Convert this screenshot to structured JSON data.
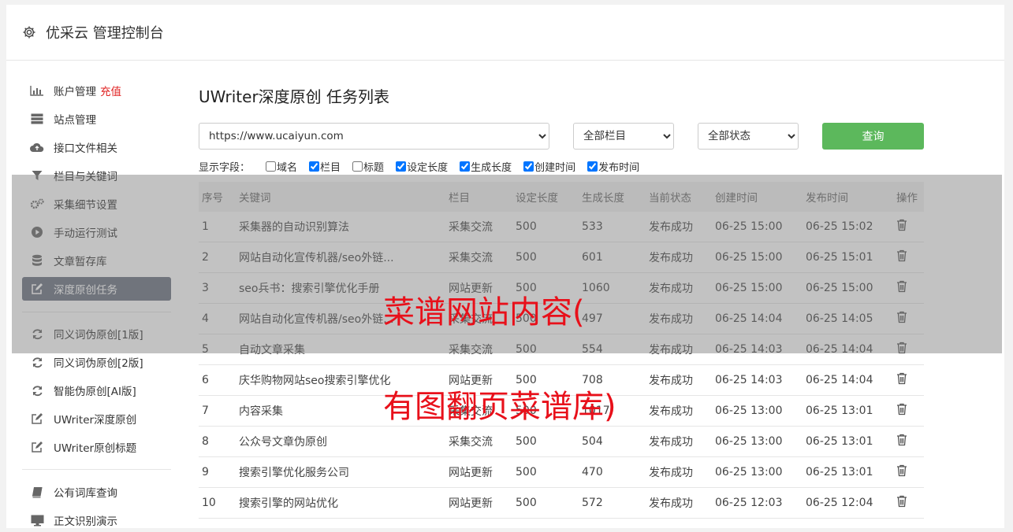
{
  "header": {
    "title": "优采云 管理控制台"
  },
  "sidebar": {
    "items": [
      {
        "label": "账户管理",
        "extra": "充值",
        "icon": "bar-chart-icon"
      },
      {
        "label": "站点管理",
        "icon": "server-icon"
      },
      {
        "label": "接口文件相关",
        "icon": "cloud-upload-icon"
      },
      {
        "label": "栏目与关键词",
        "icon": "filter-icon"
      },
      {
        "label": "采集细节设置",
        "icon": "gears-icon"
      },
      {
        "label": "手动运行测试",
        "icon": "play-circle-icon"
      },
      {
        "label": "文章暂存库",
        "icon": "database-icon"
      },
      {
        "label": "深度原创任务",
        "icon": "edit-icon",
        "active": true
      },
      {
        "label": "同义词伪原创[1版]",
        "icon": "refresh-icon"
      },
      {
        "label": "同义词伪原创[2版]",
        "icon": "refresh-icon"
      },
      {
        "label": "智能伪原创[AI版]",
        "icon": "refresh-icon"
      },
      {
        "label": "UWriter深度原创",
        "icon": "edit-icon"
      },
      {
        "label": "UWriter原创标题",
        "icon": "edit-icon"
      },
      {
        "label": "公有词库查询",
        "icon": "book-icon"
      },
      {
        "label": "正文识别演示",
        "icon": "monitor-icon"
      }
    ]
  },
  "main": {
    "title": "UWriter深度原创 任务列表",
    "site_select": {
      "value": "https://www.ucaiyun.com"
    },
    "column_select": {
      "value": "全部栏目"
    },
    "status_select": {
      "value": "全部状态"
    },
    "query_button": "查询",
    "fields_label": "显示字段：",
    "fields": [
      {
        "label": "域名",
        "checked": false
      },
      {
        "label": "栏目",
        "checked": true
      },
      {
        "label": "标题",
        "checked": false
      },
      {
        "label": "设定长度",
        "checked": true
      },
      {
        "label": "生成长度",
        "checked": true
      },
      {
        "label": "创建时间",
        "checked": true
      },
      {
        "label": "发布时间",
        "checked": true
      }
    ],
    "table": {
      "columns": [
        "序号",
        "关键词",
        "栏目",
        "设定长度",
        "生成长度",
        "当前状态",
        "创建时间",
        "发布时间",
        "操作"
      ],
      "rows": [
        [
          "1",
          "采集器的自动识别算法",
          "采集交流",
          "500",
          "533",
          "发布成功",
          "06-25 15:00",
          "06-25 15:02"
        ],
        [
          "2",
          "网站自动化宣传机器/seo外链...",
          "采集交流",
          "500",
          "601",
          "发布成功",
          "06-25 15:00",
          "06-25 15:01"
        ],
        [
          "3",
          "seo兵书：搜索引擎优化手册",
          "网站更新",
          "500",
          "1060",
          "发布成功",
          "06-25 15:00",
          "06-25 15:00"
        ],
        [
          "4",
          "网站自动化宣传机器/seo外链...",
          "采集交流",
          "500",
          "497",
          "发布成功",
          "06-25 14:04",
          "06-25 14:05"
        ],
        [
          "5",
          "自动文章采集",
          "采集交流",
          "500",
          "554",
          "发布成功",
          "06-25 14:03",
          "06-25 14:04"
        ],
        [
          "6",
          "庆华购物网站seo搜索引擎优化",
          "网站更新",
          "500",
          "708",
          "发布成功",
          "06-25 14:03",
          "06-25 14:04"
        ],
        [
          "7",
          "内容采集",
          "采集交流",
          "500",
          "1017",
          "发布成功",
          "06-25 13:00",
          "06-25 13:01"
        ],
        [
          "8",
          "公众号文章伪原创",
          "采集交流",
          "500",
          "504",
          "发布成功",
          "06-25 13:00",
          "06-25 13:01"
        ],
        [
          "9",
          "搜索引擎优化服务公司",
          "网站更新",
          "500",
          "470",
          "发布成功",
          "06-25 13:00",
          "06-25 13:01"
        ],
        [
          "10",
          "搜索引擎的网站优化",
          "网站更新",
          "500",
          "572",
          "发布成功",
          "06-25 12:03",
          "06-25 12:04"
        ]
      ]
    }
  },
  "watermark": {
    "line1": "菜谱网站内容(",
    "line2": "有图翻页菜谱库)"
  },
  "colors": {
    "active_nav": "#6b7280",
    "query_button": "#5cb85c",
    "status_ok": "#2e8b2e",
    "recharge": "#e02020",
    "watermark": "#e8101a"
  }
}
